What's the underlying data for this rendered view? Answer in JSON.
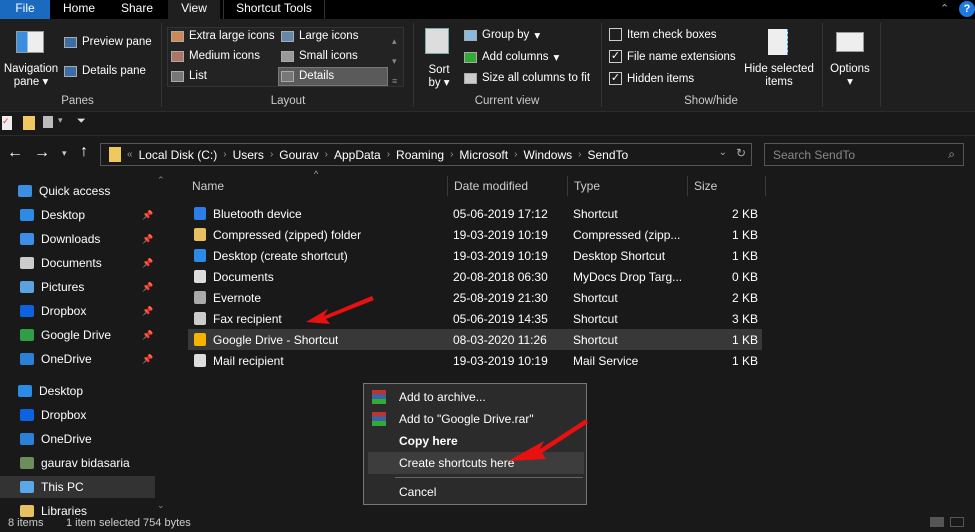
{
  "tabs": {
    "file": "File",
    "home": "Home",
    "share": "Share",
    "view": "View",
    "shortcut_tools": "Shortcut Tools"
  },
  "ribbon": {
    "panes": {
      "label": "Panes",
      "navigation_pane": "Navigation pane",
      "preview_pane": "Preview pane",
      "details_pane": "Details pane"
    },
    "layout": {
      "label": "Layout",
      "items": [
        "Extra large icons",
        "Large icons",
        "Medium icons",
        "Small icons",
        "List",
        "Details"
      ],
      "selected": "Details"
    },
    "current_view": {
      "label": "Current view",
      "sort_by": "Sort by",
      "group_by": "Group by",
      "add_columns": "Add columns",
      "size_all": "Size all columns to fit"
    },
    "show_hide": {
      "label": "Show/hide",
      "item_check_boxes": "Item check boxes",
      "item_check_boxes_checked": false,
      "file_name_extensions": "File name extensions",
      "file_name_extensions_checked": true,
      "hidden_items": "Hidden items",
      "hidden_items_checked": true,
      "hide_selected": "Hide selected items"
    },
    "options": "Options"
  },
  "address": {
    "crumbs": [
      "Local Disk (C:)",
      "Users",
      "Gourav",
      "AppData",
      "Roaming",
      "Microsoft",
      "Windows",
      "SendTo"
    ],
    "search_placeholder": "Search SendTo"
  },
  "sidebar": [
    {
      "label": "Quick access",
      "color": "#3b8ee0",
      "pin": false,
      "indent": 0
    },
    {
      "label": "Desktop",
      "color": "#2b8be5",
      "pin": true,
      "indent": 1
    },
    {
      "label": "Downloads",
      "color": "#3c8ee8",
      "pin": true,
      "indent": 1
    },
    {
      "label": "Documents",
      "color": "#ccc",
      "pin": true,
      "indent": 1
    },
    {
      "label": "Pictures",
      "color": "#5ba3e0",
      "pin": true,
      "indent": 1
    },
    {
      "label": "Dropbox",
      "color": "#0d62e0",
      "pin": true,
      "indent": 1
    },
    {
      "label": "Google Drive",
      "color": "#2f9e44",
      "pin": true,
      "indent": 1
    },
    {
      "label": "OneDrive",
      "color": "#2a82d8",
      "pin": true,
      "indent": 1
    },
    {
      "label": "Desktop",
      "color": "#2b8be5",
      "pin": false,
      "indent": 0
    },
    {
      "label": "Dropbox",
      "color": "#0d62e0",
      "pin": false,
      "indent": 1
    },
    {
      "label": "OneDrive",
      "color": "#2a82d8",
      "pin": false,
      "indent": 1
    },
    {
      "label": "gaurav bidasaria",
      "color": "#6b8e5a",
      "pin": false,
      "indent": 1
    },
    {
      "label": "This PC",
      "color": "#5aa8e8",
      "pin": false,
      "indent": 1
    },
    {
      "label": "Libraries",
      "color": "#e8c060",
      "pin": false,
      "indent": 1
    }
  ],
  "columns": {
    "name": "Name",
    "date": "Date modified",
    "type": "Type",
    "size": "Size"
  },
  "files": [
    {
      "name": "Bluetooth device",
      "date": "05-06-2019 17:12",
      "type": "Shortcut",
      "size": "2 KB",
      "color": "#2b7de9"
    },
    {
      "name": "Compressed (zipped) folder",
      "date": "19-03-2019 10:19",
      "type": "Compressed (zipp...",
      "size": "1 KB",
      "color": "#e8c060"
    },
    {
      "name": "Desktop (create shortcut)",
      "date": "19-03-2019 10:19",
      "type": "Desktop Shortcut",
      "size": "1 KB",
      "color": "#2b8be5"
    },
    {
      "name": "Documents",
      "date": "20-08-2018 06:30",
      "type": "MyDocs Drop Targ...",
      "size": "0 KB",
      "color": "#ddd"
    },
    {
      "name": "Evernote",
      "date": "25-08-2019 21:30",
      "type": "Shortcut",
      "size": "2 KB",
      "color": "#aaa"
    },
    {
      "name": "Fax recipient",
      "date": "05-06-2019 14:35",
      "type": "Shortcut",
      "size": "3 KB",
      "color": "#ccc"
    },
    {
      "name": "Google Drive - Shortcut",
      "date": "08-03-2020 11:26",
      "type": "Shortcut",
      "size": "1 KB",
      "color": "#f4b400",
      "selected": true
    },
    {
      "name": "Mail recipient",
      "date": "19-03-2019 10:19",
      "type": "Mail Service",
      "size": "1 KB",
      "color": "#ddd"
    }
  ],
  "context_menu": [
    {
      "label": "Add to archive...",
      "icon": "winrar-icon"
    },
    {
      "label": "Add to \"Google Drive.rar\"",
      "icon": "winrar-icon"
    },
    {
      "label": "Copy here",
      "bold": true
    },
    {
      "label": "Create shortcuts here",
      "highlighted": true
    },
    {
      "label": "Cancel"
    }
  ],
  "status": {
    "count": "8 items",
    "selection": "1 item selected  754 bytes"
  },
  "annotation_color": "#e81010"
}
